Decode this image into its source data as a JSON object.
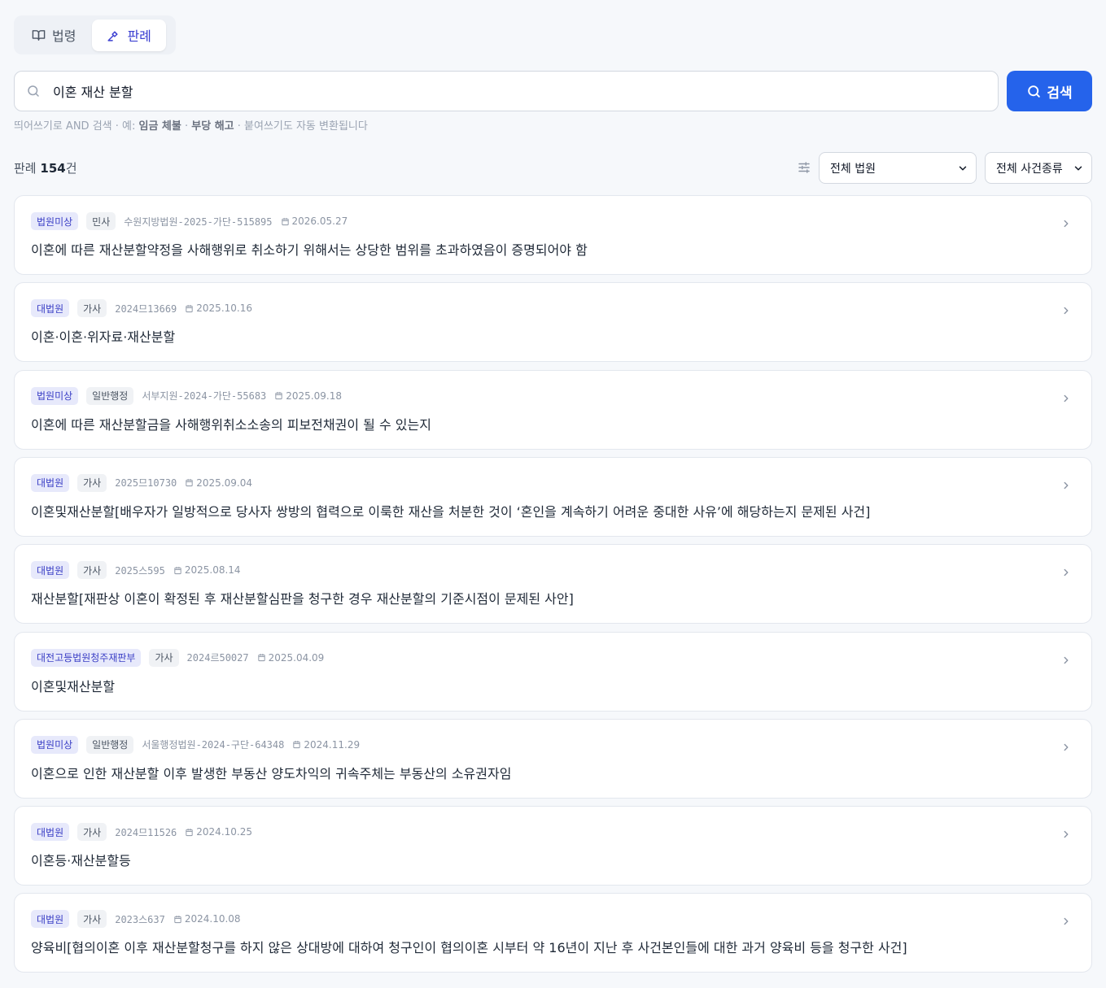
{
  "tabs": [
    {
      "label": "법령",
      "icon": "book-icon",
      "active": false
    },
    {
      "label": "판례",
      "icon": "gavel-icon",
      "active": true
    }
  ],
  "search": {
    "value": "이혼 재산 분할",
    "button_label": "검색"
  },
  "hint": {
    "prefix": "띄어쓰기로 AND 검색 · 예: ",
    "example1": "임금 체불",
    "sep": " · ",
    "example2": "부당 해고",
    "suffix": " · 붙여쓰기도 자동 변환됩니다"
  },
  "results": {
    "label": "판례",
    "count": "154",
    "unit": "건"
  },
  "filters": {
    "court": "전체 법원",
    "case_type": "전체 사건종류"
  },
  "cases": [
    {
      "court": "법원미상",
      "type": "민사",
      "case_no": "수원지방법원-2025-가단-515895",
      "date": "2026.05.27",
      "title": "이혼에 따른 재산분할약정을 사해행위로 취소하기 위해서는 상당한 범위를 초과하였음이 증명되어야 함"
    },
    {
      "court": "대법원",
      "type": "가사",
      "case_no": "2024므13669",
      "date": "2025.10.16",
      "title": "이혼·이혼·위자료·재산분할"
    },
    {
      "court": "법원미상",
      "type": "일반행정",
      "case_no": "서부지원-2024-가단-55683",
      "date": "2025.09.18",
      "title": "이혼에 따른 재산분할금을 사해행위취소소송의 피보전채권이 될 수 있는지"
    },
    {
      "court": "대법원",
      "type": "가사",
      "case_no": "2025므10730",
      "date": "2025.09.04",
      "title": "이혼및재산분할[배우자가 일방적으로 당사자 쌍방의 협력으로 이룩한 재산을 처분한 것이 ‘혼인을 계속하기 어려운 중대한 사유’에 해당하는지 문제된 사건]"
    },
    {
      "court": "대법원",
      "type": "가사",
      "case_no": "2025스595",
      "date": "2025.08.14",
      "title": "재산분할[재판상 이혼이 확정된 후 재산분할심판을 청구한 경우 재산분할의 기준시점이 문제된 사안]"
    },
    {
      "court": "대전고등법원청주재판부",
      "type": "가사",
      "case_no": "2024르50027",
      "date": "2025.04.09",
      "title": "이혼및재산분할"
    },
    {
      "court": "법원미상",
      "type": "일반행정",
      "case_no": "서울행정법원-2024-구단-64348",
      "date": "2024.11.29",
      "title": "이혼으로 인한 재산분할 이후 발생한 부동산 양도차익의 귀속주체는 부동산의 소유권자임"
    },
    {
      "court": "대법원",
      "type": "가사",
      "case_no": "2024므11526",
      "date": "2024.10.25",
      "title": "이혼등·재산분할등"
    },
    {
      "court": "대법원",
      "type": "가사",
      "case_no": "2023스637",
      "date": "2024.10.08",
      "title": "양육비[협의이혼 이후 재산분할청구를 하지 않은 상대방에 대하여 청구인이 협의이혼 시부터 약 16년이 지난 후 사건본인들에 대한 과거 양육비 등을 청구한 사건]"
    }
  ],
  "colors": {
    "primary": "#2563eb",
    "accent": "#3b3fd1",
    "court_badge_bg": "#e7e9fb"
  }
}
